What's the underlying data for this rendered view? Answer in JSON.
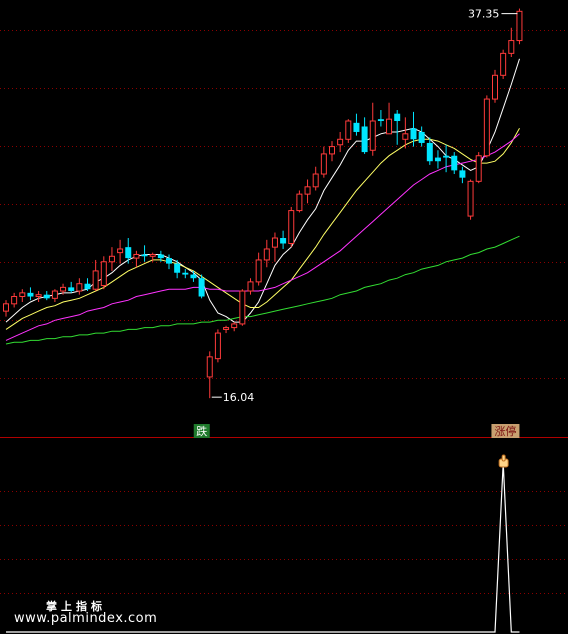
{
  "chart_data": {
    "type": "candlestick",
    "colors": {
      "up": "#ff3b3b",
      "down": "#00e5ff",
      "background": "#000000",
      "grid": "#8b0000",
      "separator": "#b00000",
      "ma5": "#ffffff",
      "ma10": "#ffff66",
      "ma20": "#ff33ff",
      "ma60": "#33dd33",
      "tag_down_bg": "#1f7a2c",
      "tag_down_text": "#ffffff",
      "tag_up_bg": "#c8a070",
      "tag_up_text": "#7a1010",
      "price_label": "#ffffff",
      "indicator": "#ffffff"
    },
    "price_range": [
      14.9,
      37.6
    ],
    "candles": [
      {
        "o": 20.8,
        "h": 21.4,
        "l": 20.5,
        "c": 21.2,
        "up": true
      },
      {
        "o": 21.2,
        "h": 21.8,
        "l": 21.0,
        "c": 21.6,
        "up": true
      },
      {
        "o": 21.6,
        "h": 22.0,
        "l": 21.3,
        "c": 21.8,
        "up": true
      },
      {
        "o": 21.8,
        "h": 22.1,
        "l": 21.4,
        "c": 21.6,
        "up": false
      },
      {
        "o": 21.6,
        "h": 21.9,
        "l": 21.3,
        "c": 21.7,
        "up": true
      },
      {
        "o": 21.7,
        "h": 21.9,
        "l": 21.4,
        "c": 21.5,
        "up": false
      },
      {
        "o": 21.5,
        "h": 22.0,
        "l": 21.3,
        "c": 21.9,
        "up": true
      },
      {
        "o": 21.9,
        "h": 22.3,
        "l": 21.7,
        "c": 22.1,
        "up": true
      },
      {
        "o": 22.1,
        "h": 22.4,
        "l": 21.8,
        "c": 21.9,
        "up": false
      },
      {
        "o": 21.9,
        "h": 22.6,
        "l": 21.7,
        "c": 22.3,
        "up": true
      },
      {
        "o": 22.3,
        "h": 22.6,
        "l": 21.9,
        "c": 22.0,
        "up": false
      },
      {
        "o": 22.0,
        "h": 23.6,
        "l": 21.9,
        "c": 23.0,
        "up": true
      },
      {
        "o": 22.2,
        "h": 23.8,
        "l": 22.0,
        "c": 23.5,
        "up": true
      },
      {
        "o": 23.5,
        "h": 24.3,
        "l": 23.0,
        "c": 23.8,
        "up": true
      },
      {
        "o": 24.0,
        "h": 24.7,
        "l": 23.4,
        "c": 24.2,
        "up": true
      },
      {
        "o": 24.3,
        "h": 24.8,
        "l": 23.4,
        "c": 23.7,
        "up": false
      },
      {
        "o": 23.7,
        "h": 24.1,
        "l": 23.2,
        "c": 23.9,
        "up": true
      },
      {
        "o": 23.9,
        "h": 24.4,
        "l": 23.5,
        "c": 23.8,
        "up": false
      },
      {
        "o": 23.8,
        "h": 24.0,
        "l": 23.5,
        "c": 23.9,
        "up": true
      },
      {
        "o": 23.9,
        "h": 24.1,
        "l": 23.5,
        "c": 23.7,
        "up": false
      },
      {
        "o": 23.7,
        "h": 23.9,
        "l": 23.1,
        "c": 23.4,
        "up": false
      },
      {
        "o": 23.4,
        "h": 23.6,
        "l": 22.6,
        "c": 22.9,
        "up": false
      },
      {
        "o": 22.9,
        "h": 23.1,
        "l": 22.6,
        "c": 22.8,
        "up": false
      },
      {
        "o": 22.8,
        "h": 23.0,
        "l": 22.4,
        "c": 22.6,
        "up": false
      },
      {
        "o": 22.6,
        "h": 22.8,
        "l": 21.5,
        "c": 21.6,
        "up": false
      },
      {
        "o": 17.2,
        "h": 18.6,
        "l": 16.04,
        "c": 18.3,
        "up": true
      },
      {
        "o": 18.2,
        "h": 19.8,
        "l": 18.0,
        "c": 19.6,
        "up": true
      },
      {
        "o": 19.8,
        "h": 20.0,
        "l": 19.6,
        "c": 19.9,
        "up": true
      },
      {
        "o": 19.9,
        "h": 20.2,
        "l": 19.7,
        "c": 20.1,
        "up": true
      },
      {
        "o": 20.1,
        "h": 22.0,
        "l": 20.0,
        "c": 21.9,
        "up": true
      },
      {
        "o": 21.9,
        "h": 22.6,
        "l": 21.7,
        "c": 22.4,
        "up": true
      },
      {
        "o": 22.4,
        "h": 24.0,
        "l": 22.2,
        "c": 23.6,
        "up": true
      },
      {
        "o": 23.6,
        "h": 24.7,
        "l": 23.2,
        "c": 24.2,
        "up": true
      },
      {
        "o": 24.3,
        "h": 25.1,
        "l": 23.5,
        "c": 24.8,
        "up": true
      },
      {
        "o": 24.8,
        "h": 25.2,
        "l": 24.2,
        "c": 24.5,
        "up": false
      },
      {
        "o": 24.5,
        "h": 26.5,
        "l": 24.3,
        "c": 26.3,
        "up": true
      },
      {
        "o": 26.3,
        "h": 27.4,
        "l": 26.2,
        "c": 27.2,
        "up": true
      },
      {
        "o": 27.2,
        "h": 28.0,
        "l": 26.7,
        "c": 27.6,
        "up": true
      },
      {
        "o": 27.6,
        "h": 28.7,
        "l": 27.4,
        "c": 28.3,
        "up": true
      },
      {
        "o": 28.3,
        "h": 29.8,
        "l": 28.1,
        "c": 29.4,
        "up": true
      },
      {
        "o": 29.4,
        "h": 30.1,
        "l": 29.0,
        "c": 29.8,
        "up": true
      },
      {
        "o": 29.9,
        "h": 30.6,
        "l": 29.5,
        "c": 30.2,
        "up": true
      },
      {
        "o": 30.2,
        "h": 31.3,
        "l": 30.0,
        "c": 31.2,
        "up": true
      },
      {
        "o": 31.1,
        "h": 31.6,
        "l": 30.4,
        "c": 30.6,
        "up": false
      },
      {
        "o": 30.9,
        "h": 31.4,
        "l": 29.4,
        "c": 29.5,
        "up": false
      },
      {
        "o": 29.6,
        "h": 32.2,
        "l": 29.3,
        "c": 31.2,
        "up": true
      },
      {
        "o": 31.2,
        "h": 31.8,
        "l": 30.9,
        "c": 31.3,
        "up": false
      },
      {
        "o": 31.3,
        "h": 32.2,
        "l": 30.5,
        "c": 30.5,
        "up": true
      },
      {
        "o": 31.6,
        "h": 31.8,
        "l": 29.9,
        "c": 31.2,
        "up": false
      },
      {
        "o": 30.5,
        "h": 31.4,
        "l": 29.7,
        "c": 30.2,
        "up": true
      },
      {
        "o": 30.2,
        "h": 31.7,
        "l": 29.8,
        "c": 30.8,
        "up": false
      },
      {
        "o": 30.6,
        "h": 30.9,
        "l": 29.8,
        "c": 30.0,
        "up": false
      },
      {
        "o": 30.0,
        "h": 30.3,
        "l": 28.8,
        "c": 29.0,
        "up": false
      },
      {
        "o": 29.0,
        "h": 29.6,
        "l": 28.6,
        "c": 29.2,
        "up": false
      },
      {
        "o": 29.2,
        "h": 29.9,
        "l": 28.4,
        "c": 29.3,
        "up": false
      },
      {
        "o": 29.3,
        "h": 29.5,
        "l": 28.3,
        "c": 28.5,
        "up": false
      },
      {
        "o": 28.5,
        "h": 28.7,
        "l": 27.8,
        "c": 28.1,
        "up": false
      },
      {
        "o": 26.0,
        "h": 28.0,
        "l": 25.8,
        "c": 27.9,
        "up": true
      },
      {
        "o": 27.9,
        "h": 29.5,
        "l": 27.8,
        "c": 29.3,
        "up": true
      },
      {
        "o": 29.3,
        "h": 32.6,
        "l": 29.2,
        "c": 32.4,
        "up": true
      },
      {
        "o": 32.4,
        "h": 34.0,
        "l": 32.2,
        "c": 33.7,
        "up": true
      },
      {
        "o": 33.7,
        "h": 35.1,
        "l": 33.5,
        "c": 34.9,
        "up": true
      },
      {
        "o": 34.9,
        "h": 36.3,
        "l": 34.7,
        "c": 35.6,
        "up": true
      },
      {
        "o": 35.6,
        "h": 37.35,
        "l": 35.4,
        "c": 37.2,
        "up": true
      }
    ],
    "moving_averages": [
      {
        "name": "MA5",
        "color_key": "ma5",
        "values": [
          20.2,
          20.6,
          21.0,
          21.3,
          21.5,
          21.6,
          21.7,
          21.8,
          21.8,
          21.9,
          22.0,
          22.4,
          22.6,
          22.9,
          23.3,
          23.6,
          23.8,
          23.9,
          23.9,
          23.9,
          23.7,
          23.5,
          23.2,
          22.9,
          22.5,
          21.4,
          20.7,
          20.5,
          20.2,
          20.2,
          20.7,
          21.3,
          22.3,
          23.3,
          23.9,
          24.3,
          25.1,
          25.8,
          26.4,
          27.4,
          28.1,
          28.8,
          29.6,
          30.1,
          30.1,
          30.3,
          30.5,
          30.6,
          30.6,
          30.7,
          30.8,
          30.6,
          30.2,
          29.8,
          29.3,
          29.1,
          28.8,
          28.5,
          28.7,
          29.6,
          30.6,
          31.9,
          33.2,
          34.6
        ]
      },
      {
        "name": "MA10",
        "color_key": "ma10",
        "values": [
          19.8,
          20.1,
          20.4,
          20.6,
          20.8,
          21.0,
          21.1,
          21.3,
          21.4,
          21.5,
          21.7,
          21.9,
          22.1,
          22.4,
          22.7,
          23.0,
          23.2,
          23.4,
          23.6,
          23.6,
          23.5,
          23.4,
          23.2,
          23.0,
          22.7,
          22.4,
          22.1,
          21.8,
          21.5,
          21.2,
          21.0,
          21.0,
          21.3,
          21.7,
          22.1,
          22.5,
          23.1,
          23.7,
          24.3,
          25.0,
          25.6,
          26.2,
          26.8,
          27.4,
          27.9,
          28.4,
          28.9,
          29.3,
          29.6,
          29.9,
          30.1,
          30.2,
          30.2,
          30.1,
          29.9,
          29.7,
          29.4,
          29.1,
          28.9,
          28.9,
          29.0,
          29.4,
          30.0,
          30.8
        ]
      },
      {
        "name": "MA20",
        "color_key": "ma20",
        "values": [
          19.2,
          19.4,
          19.6,
          19.8,
          20.0,
          20.1,
          20.3,
          20.4,
          20.5,
          20.6,
          20.8,
          20.9,
          21.0,
          21.2,
          21.3,
          21.4,
          21.6,
          21.7,
          21.8,
          21.9,
          22.0,
          22.0,
          22.0,
          22.1,
          22.1,
          22.0,
          22.0,
          21.9,
          21.9,
          21.9,
          21.9,
          21.9,
          22.0,
          22.1,
          22.3,
          22.5,
          22.7,
          22.9,
          23.2,
          23.5,
          23.8,
          24.1,
          24.5,
          24.9,
          25.3,
          25.7,
          26.1,
          26.5,
          26.9,
          27.3,
          27.7,
          28.0,
          28.3,
          28.5,
          28.7,
          28.8,
          28.9,
          29.0,
          29.1,
          29.3,
          29.5,
          29.8,
          30.1,
          30.5
        ]
      },
      {
        "name": "MA60",
        "color_key": "ma60",
        "values": [
          19.0,
          19.1,
          19.1,
          19.2,
          19.2,
          19.3,
          19.3,
          19.4,
          19.4,
          19.5,
          19.5,
          19.6,
          19.6,
          19.7,
          19.7,
          19.8,
          19.8,
          19.9,
          19.9,
          20.0,
          20.0,
          20.1,
          20.1,
          20.1,
          20.2,
          20.2,
          20.3,
          20.3,
          20.4,
          20.5,
          20.5,
          20.6,
          20.7,
          20.8,
          20.9,
          21.0,
          21.1,
          21.2,
          21.3,
          21.4,
          21.5,
          21.7,
          21.8,
          21.9,
          22.1,
          22.2,
          22.3,
          22.5,
          22.6,
          22.8,
          22.9,
          23.1,
          23.2,
          23.3,
          23.5,
          23.6,
          23.7,
          23.9,
          24.0,
          24.2,
          24.3,
          24.5,
          24.7,
          24.9
        ]
      }
    ],
    "annotations": {
      "high_label": "37.35",
      "high_index": 63,
      "high_value": 37.35,
      "low_label": "16.04",
      "low_index": 25,
      "low_value": 16.04,
      "tag_down": {
        "text": "跌",
        "index": 25
      },
      "tag_up": {
        "text": "涨停",
        "index": 63
      }
    },
    "indicator": {
      "values": [
        0,
        0,
        0,
        0,
        0,
        0,
        0,
        0,
        0,
        0,
        0,
        0,
        0,
        0,
        0,
        0,
        0,
        0,
        0,
        0,
        0,
        0,
        0,
        0,
        0,
        0,
        0,
        0,
        0,
        0,
        0,
        0,
        0,
        0,
        0,
        0,
        0,
        0,
        0,
        0,
        0,
        0,
        0,
        0,
        0,
        0,
        0,
        0,
        0,
        0,
        0,
        0,
        0,
        0,
        0,
        0,
        0,
        0,
        0,
        0,
        0,
        1,
        0,
        0
      ],
      "marker_index": 61
    }
  },
  "watermark": {
    "cn": "掌上指标",
    "url": "www.palmindex.com"
  }
}
